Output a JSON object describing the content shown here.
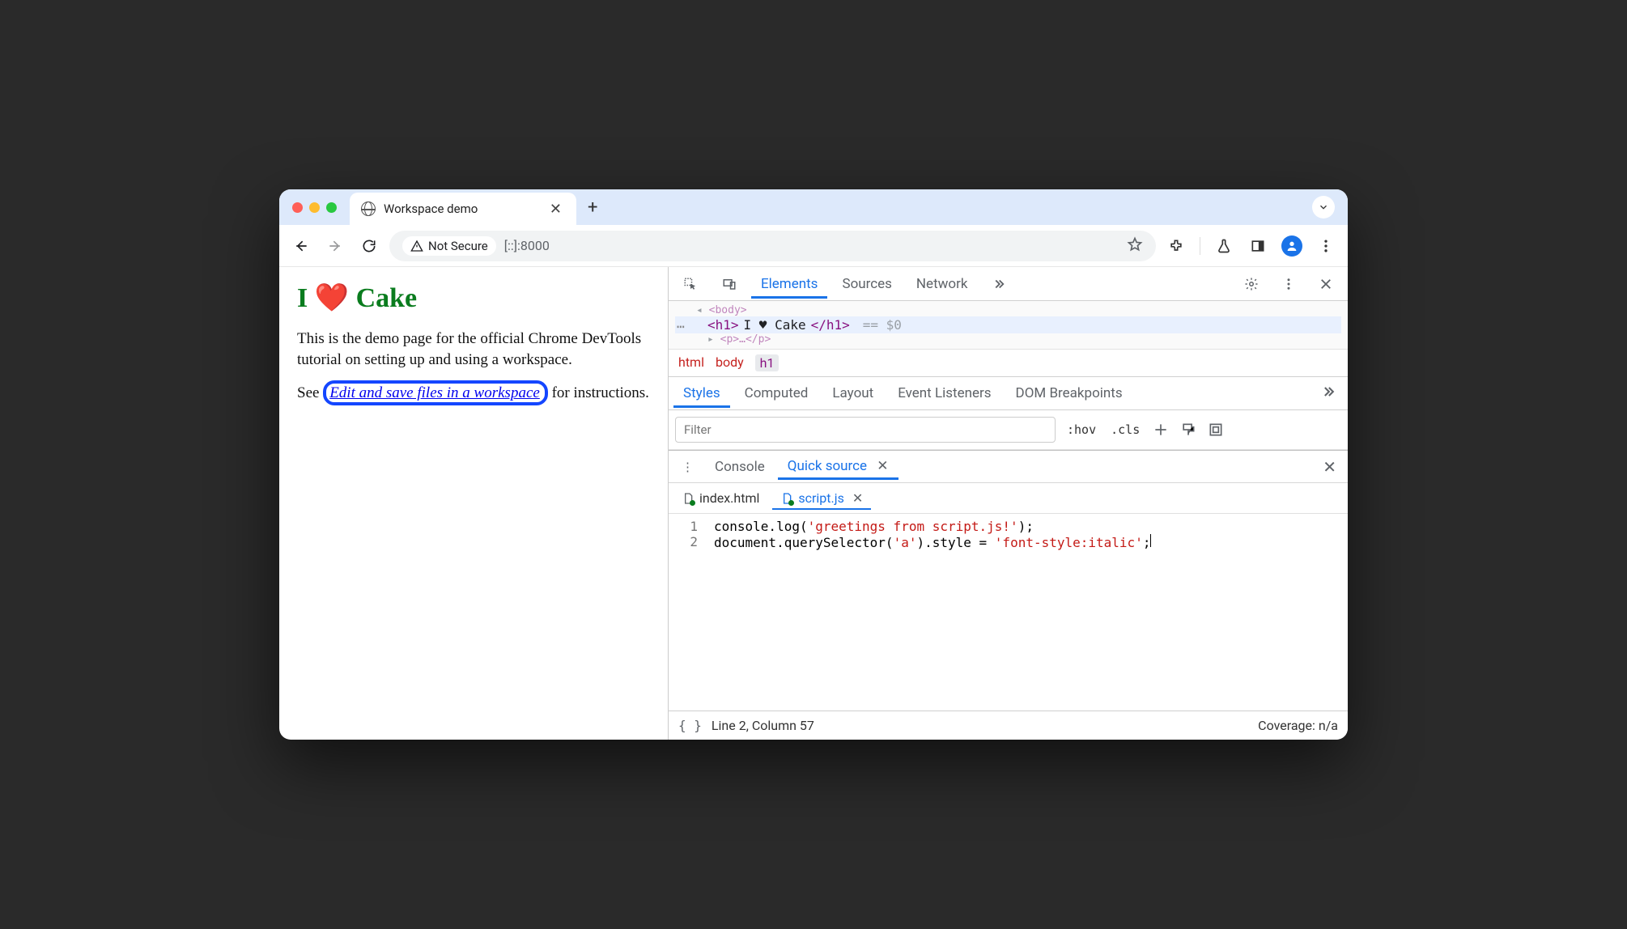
{
  "window": {
    "tab_title": "Workspace demo"
  },
  "toolbar": {
    "secure_label": "Not Secure",
    "address": "[::]:8000"
  },
  "page": {
    "heading": "I ❤️ Cake",
    "para1": "This is the demo page for the official Chrome DevTools tutorial on setting up and using a workspace.",
    "para2_before": "See ",
    "para2_link": "Edit and save files in a workspace",
    "para2_after": " for instructions."
  },
  "devtools": {
    "tabs": [
      "Elements",
      "Sources",
      "Network"
    ],
    "active_tab": "Elements",
    "dom": {
      "prev_line": "<body>",
      "selected_open": "<h1>",
      "selected_text": "I ♥ Cake",
      "selected_close": "</h1>",
      "eq": "== $0",
      "next_hint": "<p>…</p>"
    },
    "crumbs": [
      "html",
      "body",
      "h1"
    ],
    "style_tabs": [
      "Styles",
      "Computed",
      "Layout",
      "Event Listeners",
      "DOM Breakpoints"
    ],
    "filter_placeholder": "Filter",
    "pills": {
      "hov": ":hov",
      "cls": ".cls"
    },
    "drawer_tabs": [
      "Console",
      "Quick source"
    ],
    "drawer_active": "Quick source",
    "file_tabs": [
      {
        "name": "index.html",
        "active": false
      },
      {
        "name": "script.js",
        "active": true
      }
    ],
    "code": {
      "line_numbers": [
        "1",
        "2"
      ],
      "line1_a": "console.log(",
      "line1_str": "'greetings from script.js!'",
      "line1_b": ");",
      "line2_a": "document.querySelector(",
      "line2_str1": "'a'",
      "line2_b": ").style = ",
      "line2_str2": "'font-style:italic'",
      "line2_c": ";"
    },
    "status": {
      "pos": "Line 2, Column 57",
      "coverage": "Coverage: n/a"
    }
  }
}
